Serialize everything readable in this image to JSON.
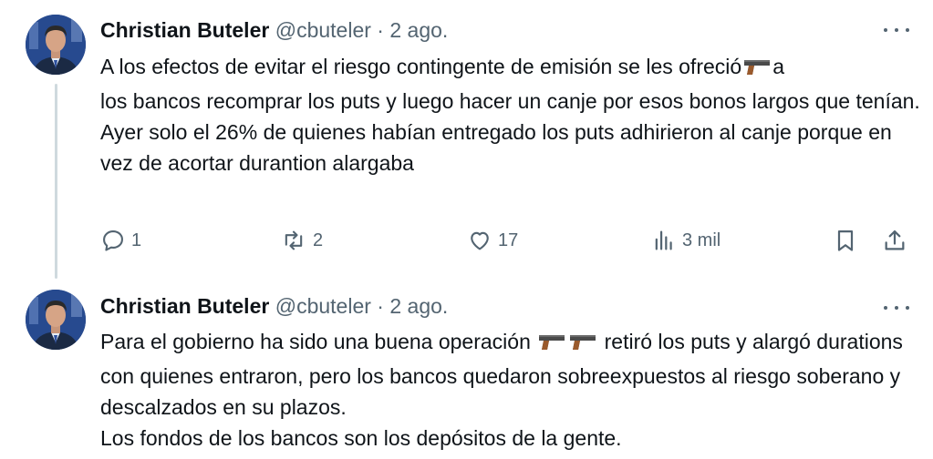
{
  "tweets": [
    {
      "author_name": "Christian Buteler",
      "handle": "@cbuteler",
      "separator": "·",
      "date": "2 ago.",
      "paragraphs": [
        {
          "line1_before": "A los efectos de evitar el riesgo contingente de emisión se les ofreció",
          "line1_after": "a",
          "rest": "los bancos recomprar los puts y luego hacer un canje por esos bonos largos que tenían."
        },
        {
          "text": "Ayer solo el 26% de quienes habían entregado los puts adhirieron al canje porque en vez de acortar durantion alargaba"
        }
      ],
      "actions": {
        "replies": "1",
        "reposts": "2",
        "likes": "17",
        "views": "3 mil"
      }
    },
    {
      "author_name": "Christian Buteler",
      "handle": "@cbuteler",
      "separator": "·",
      "date": "2 ago.",
      "paragraphs": [
        {
          "before": "Para el gobierno ha sido una buena operación",
          "after": "retiró los puts y alargó durations con quienes entraron, pero los bancos quedaron sobreexpuestos al riesgo soberano y descalzados en su plazos."
        },
        {
          "text": "Los fondos de los bancos son los depósitos de la gente."
        }
      ]
    }
  ],
  "icons": {
    "reply": "reply-icon",
    "repost": "repost-icon",
    "like": "like-icon",
    "views": "views-icon",
    "bookmark": "bookmark-icon",
    "share": "share-icon",
    "more": "more-icon",
    "emoji": "pistol-emoji-icon"
  },
  "colors": {
    "text": "#0f1419",
    "secondary": "#536471",
    "thread_line": "#cfd9de"
  }
}
